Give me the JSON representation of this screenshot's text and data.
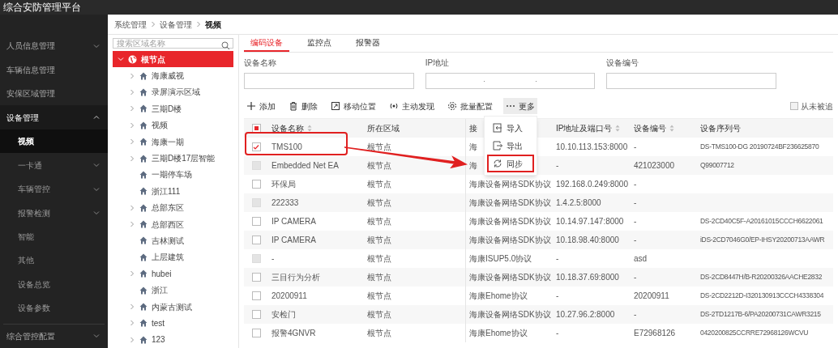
{
  "header": {
    "title": "综合安防管理平台"
  },
  "sidebar": {
    "items": [
      {
        "label": "人员信息管理",
        "has_children": true,
        "expanded": false
      },
      {
        "label": "车辆信息管理",
        "has_children": false,
        "expanded": false
      },
      {
        "label": "安保区域管理",
        "has_children": false,
        "expanded": false
      },
      {
        "label": "设备管理",
        "has_children": true,
        "expanded": true,
        "children": [
          {
            "label": "视频",
            "has_children": false,
            "selected": true
          },
          {
            "label": "一卡通",
            "has_children": true,
            "selected": false
          },
          {
            "label": "车辆管控",
            "has_children": true,
            "selected": false
          },
          {
            "label": "报警检测",
            "has_children": true,
            "selected": false
          },
          {
            "label": "智能",
            "has_children": false,
            "selected": false
          },
          {
            "label": "其他",
            "has_children": false,
            "selected": false
          },
          {
            "label": "设备总览",
            "has_children": false,
            "selected": false
          },
          {
            "label": "设备参数",
            "has_children": false,
            "selected": false
          }
        ]
      },
      {
        "label": "综合管控配置",
        "has_children": true,
        "expanded": false
      }
    ]
  },
  "breadcrumb": [
    "系统管理",
    "设备管理",
    "视频"
  ],
  "tree": {
    "search": {
      "placeholder": "搜索区域名称"
    },
    "root": {
      "label": "根节点",
      "expanded": true,
      "selected": true,
      "children": [
        {
          "label": "海康威视",
          "has_children": true
        },
        {
          "label": "录屏演示区域",
          "has_children": true
        },
        {
          "label": "三期D楼",
          "has_children": true
        },
        {
          "label": "视频",
          "has_children": true
        },
        {
          "label": "海康一期",
          "has_children": true
        },
        {
          "label": "三期D楼17层智能",
          "has_children": true
        },
        {
          "label": "一期停车场",
          "has_children": false
        },
        {
          "label": "浙江111",
          "has_children": false
        },
        {
          "label": "总部东区",
          "has_children": true
        },
        {
          "label": "总部西区",
          "has_children": true
        },
        {
          "label": "吉林测试",
          "has_children": false
        },
        {
          "label": "上层建筑",
          "has_children": false
        },
        {
          "label": "hubei",
          "has_children": true
        },
        {
          "label": "浙江",
          "has_children": false
        },
        {
          "label": "内蒙古测试",
          "has_children": true
        },
        {
          "label": "test",
          "has_children": true
        },
        {
          "label": "123",
          "has_children": true
        }
      ]
    }
  },
  "tabs": [
    {
      "label": "编码设备",
      "selected": true
    },
    {
      "label": "监控点",
      "selected": false
    },
    {
      "label": "报警器",
      "selected": false
    }
  ],
  "filters": [
    {
      "label": "设备名称",
      "kind": "text"
    },
    {
      "label": "IP地址",
      "kind": "ip"
    },
    {
      "label": "设备编号",
      "kind": "text"
    }
  ],
  "toolbar": [
    {
      "label": "添加",
      "kind": "add",
      "active": false
    },
    {
      "label": "删除",
      "kind": "delete",
      "active": false
    },
    {
      "label": "移动位置",
      "kind": "move",
      "active": false
    },
    {
      "label": "主动发现",
      "kind": "discover",
      "active": false
    },
    {
      "label": "批量配置",
      "kind": "config",
      "active": false
    },
    {
      "label": "更多",
      "kind": "more",
      "active": true
    }
  ],
  "toolbar_option": {
    "label": "从未被追",
    "checked": false
  },
  "more_menu": [
    {
      "label": "导入",
      "kind": "import",
      "highlighted": false
    },
    {
      "label": "导出",
      "kind": "export",
      "highlighted": false
    },
    {
      "label": "同步",
      "kind": "sync",
      "highlighted": true
    }
  ],
  "table": {
    "header_checkbox": {
      "indeterminate": true
    },
    "columns": [
      {
        "label": "设备名称",
        "sortable": true
      },
      {
        "label": "所在区域",
        "sortable": false
      },
      {
        "label": "接",
        "sortable": false
      },
      {
        "label": "IP地址及端口号",
        "sortable": true
      },
      {
        "label": "设备编号",
        "sortable": true
      },
      {
        "label": "设备序列号",
        "sortable": false
      }
    ],
    "rows": [
      {
        "checked": true,
        "disabled": false,
        "cells": [
          "TMS100",
          "根节点",
          "海",
          "10.10.113.153:8000",
          "-",
          "DS-TMS100-DG 20190724BF236625870"
        ]
      },
      {
        "checked": false,
        "disabled": true,
        "cells": [
          "Embedded Net EA",
          "根节点",
          "海",
          "-",
          "421023000",
          "Q99007712"
        ]
      },
      {
        "checked": false,
        "disabled": false,
        "cells": [
          "环保局",
          "根节点",
          "海康设备网络SDK协议",
          "192.168.0.249:8000",
          "-",
          ""
        ]
      },
      {
        "checked": false,
        "disabled": true,
        "cells": [
          "222333",
          "根节点",
          "海康设备网络SDK协议",
          "1.4.2.5:8000",
          "-",
          ""
        ]
      },
      {
        "checked": false,
        "disabled": false,
        "cells": [
          "IP CAMERA",
          "根节点",
          "海康设备网络SDK协议",
          "10.14.97.147:8000",
          "-",
          "DS-2CD40C5F-A20161015CCCH6622061"
        ]
      },
      {
        "checked": false,
        "disabled": false,
        "cells": [
          "IP CAMERA",
          "根节点",
          "海康设备网络SDK协议",
          "10.18.98.40:8000",
          "-",
          "iDS-2CD7046G0/EP-IHSY20200713AAWR"
        ]
      },
      {
        "checked": false,
        "disabled": true,
        "cells": [
          "-",
          "根节点",
          "海康ISUP5.0协议",
          "-",
          "asd",
          ""
        ]
      },
      {
        "checked": false,
        "disabled": false,
        "cells": [
          "三目行为分析",
          "根节点",
          "海康设备网络SDK协议",
          "10.18.37.69:8000",
          "-",
          "DS-2CD8447H/B-R20200326AACHE2832"
        ]
      },
      {
        "checked": false,
        "disabled": false,
        "cells": [
          "20200911",
          "根节点",
          "海康Ehome协议",
          "-",
          "20200911",
          "DS-2CD2212D-I320130913CCCH4338304"
        ]
      },
      {
        "checked": false,
        "disabled": false,
        "cells": [
          "安检门",
          "根节点",
          "海康设备网络SDK协议",
          "10.27.96.2:8000",
          "-",
          "DS-2TD1217B-6/PA20200731CAWR3215"
        ]
      },
      {
        "checked": false,
        "disabled": false,
        "cells": [
          "报警4GNVR",
          "根节点",
          "海康Ehome协议",
          "-",
          "E72968126",
          "0420200825CCRRE72968126WCVU"
        ]
      }
    ]
  }
}
